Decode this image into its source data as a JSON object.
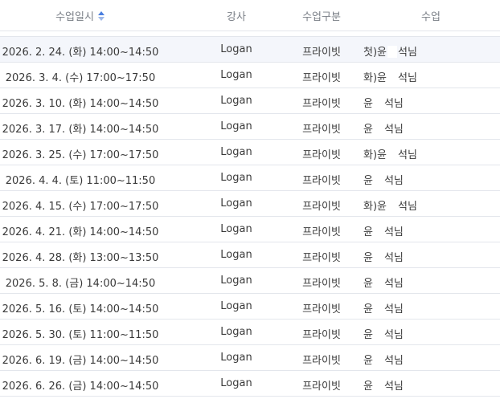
{
  "header": {
    "date_label": "수업일시",
    "teacher_label": "강사",
    "type_label": "수업구분",
    "class_label": "수업"
  },
  "rows": [
    {
      "date": "2026. 2. 24. (화) 14:00~14:50",
      "teacher": "Logan",
      "type": "프라이빗",
      "prefix": "첫)윤",
      "suffix": "석님"
    },
    {
      "date": "2026. 3. 4. (수) 17:00~17:50",
      "teacher": "Logan",
      "type": "프라이빗",
      "prefix": "화)윤",
      "suffix": "석님"
    },
    {
      "date": "2026. 3. 10. (화) 14:00~14:50",
      "teacher": "Logan",
      "type": "프라이빗",
      "prefix": "윤",
      "suffix": "석님"
    },
    {
      "date": "2026. 3. 17. (화) 14:00~14:50",
      "teacher": "Logan",
      "type": "프라이빗",
      "prefix": "윤",
      "suffix": "석님"
    },
    {
      "date": "2026. 3. 25. (수) 17:00~17:50",
      "teacher": "Logan",
      "type": "프라이빗",
      "prefix": "화)윤",
      "suffix": "석님"
    },
    {
      "date": "2026. 4. 4. (토) 11:00~11:50",
      "teacher": "Logan",
      "type": "프라이빗",
      "prefix": "윤",
      "suffix": "석님"
    },
    {
      "date": "2026. 4. 15. (수) 17:00~17:50",
      "teacher": "Logan",
      "type": "프라이빗",
      "prefix": "화)윤",
      "suffix": "석님"
    },
    {
      "date": "2026. 4. 21. (화) 14:00~14:50",
      "teacher": "Logan",
      "type": "프라이빗",
      "prefix": "윤",
      "suffix": "석님"
    },
    {
      "date": "2026. 4. 28. (화) 13:00~13:50",
      "teacher": "Logan",
      "type": "프라이빗",
      "prefix": "윤",
      "suffix": "석님"
    },
    {
      "date": "2026. 5. 8. (금) 14:00~14:50",
      "teacher": "Logan",
      "type": "프라이빗",
      "prefix": "윤",
      "suffix": "석님"
    },
    {
      "date": "2026. 5. 16. (토) 14:00~14:50",
      "teacher": "Logan",
      "type": "프라이빗",
      "prefix": "윤",
      "suffix": "석님"
    },
    {
      "date": "2026. 5. 30. (토) 11:00~11:50",
      "teacher": "Logan",
      "type": "프라이빗",
      "prefix": "윤",
      "suffix": "석님"
    },
    {
      "date": "2026. 6. 19. (금) 14:00~14:50",
      "teacher": "Logan",
      "type": "프라이빗",
      "prefix": "윤",
      "suffix": "석님"
    },
    {
      "date": "2026. 6. 26. (금) 14:00~14:50",
      "teacher": "Logan",
      "type": "프라이빗",
      "prefix": "윤",
      "suffix": "석님"
    }
  ],
  "colors": {
    "sort_icon": "#4a7fe0",
    "highlight_row": "#f4f6fb",
    "border": "#e3e6ec"
  },
  "icons": {
    "sort": "sort-icon"
  }
}
